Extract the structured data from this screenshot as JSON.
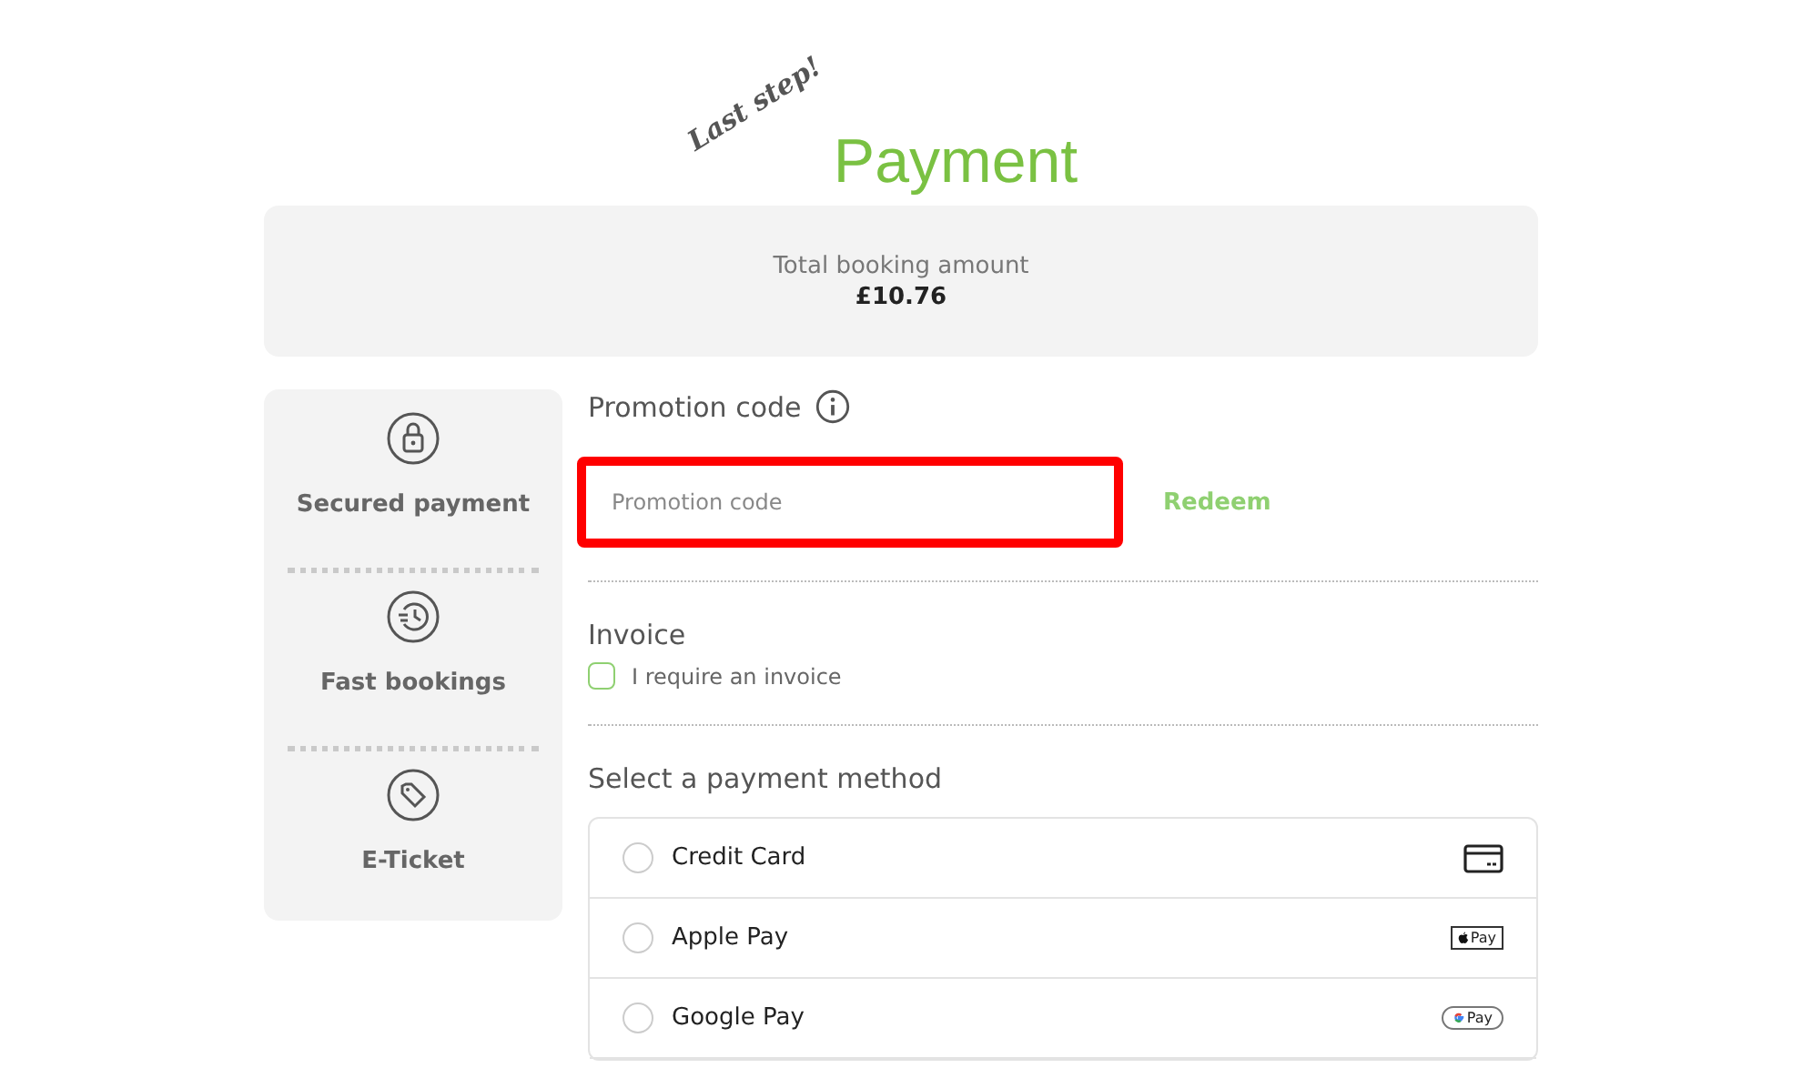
{
  "header": {
    "tagline": "Last step!",
    "title": "Payment"
  },
  "summary": {
    "label": "Total booking amount",
    "amount": "£10.76"
  },
  "features": [
    {
      "kind": "lock",
      "label": "Secured payment"
    },
    {
      "kind": "clock",
      "label": "Fast bookings"
    },
    {
      "kind": "tag",
      "label": "E-Ticket"
    }
  ],
  "promotion": {
    "heading": "Promotion code",
    "placeholder": "Promotion code",
    "highlighted": true,
    "button": "Redeem"
  },
  "invoice": {
    "heading": "Invoice",
    "label": "I require an invoice",
    "checked": false
  },
  "payment": {
    "heading": "Select a payment method",
    "methods": [
      {
        "label": "Credit Card",
        "selected": false,
        "kind": "card"
      },
      {
        "label": "Apple Pay",
        "selected": false,
        "kind": "apple",
        "badge": "Pay"
      },
      {
        "label": "Google Pay",
        "selected": false,
        "kind": "google",
        "badge": "Pay"
      }
    ]
  }
}
